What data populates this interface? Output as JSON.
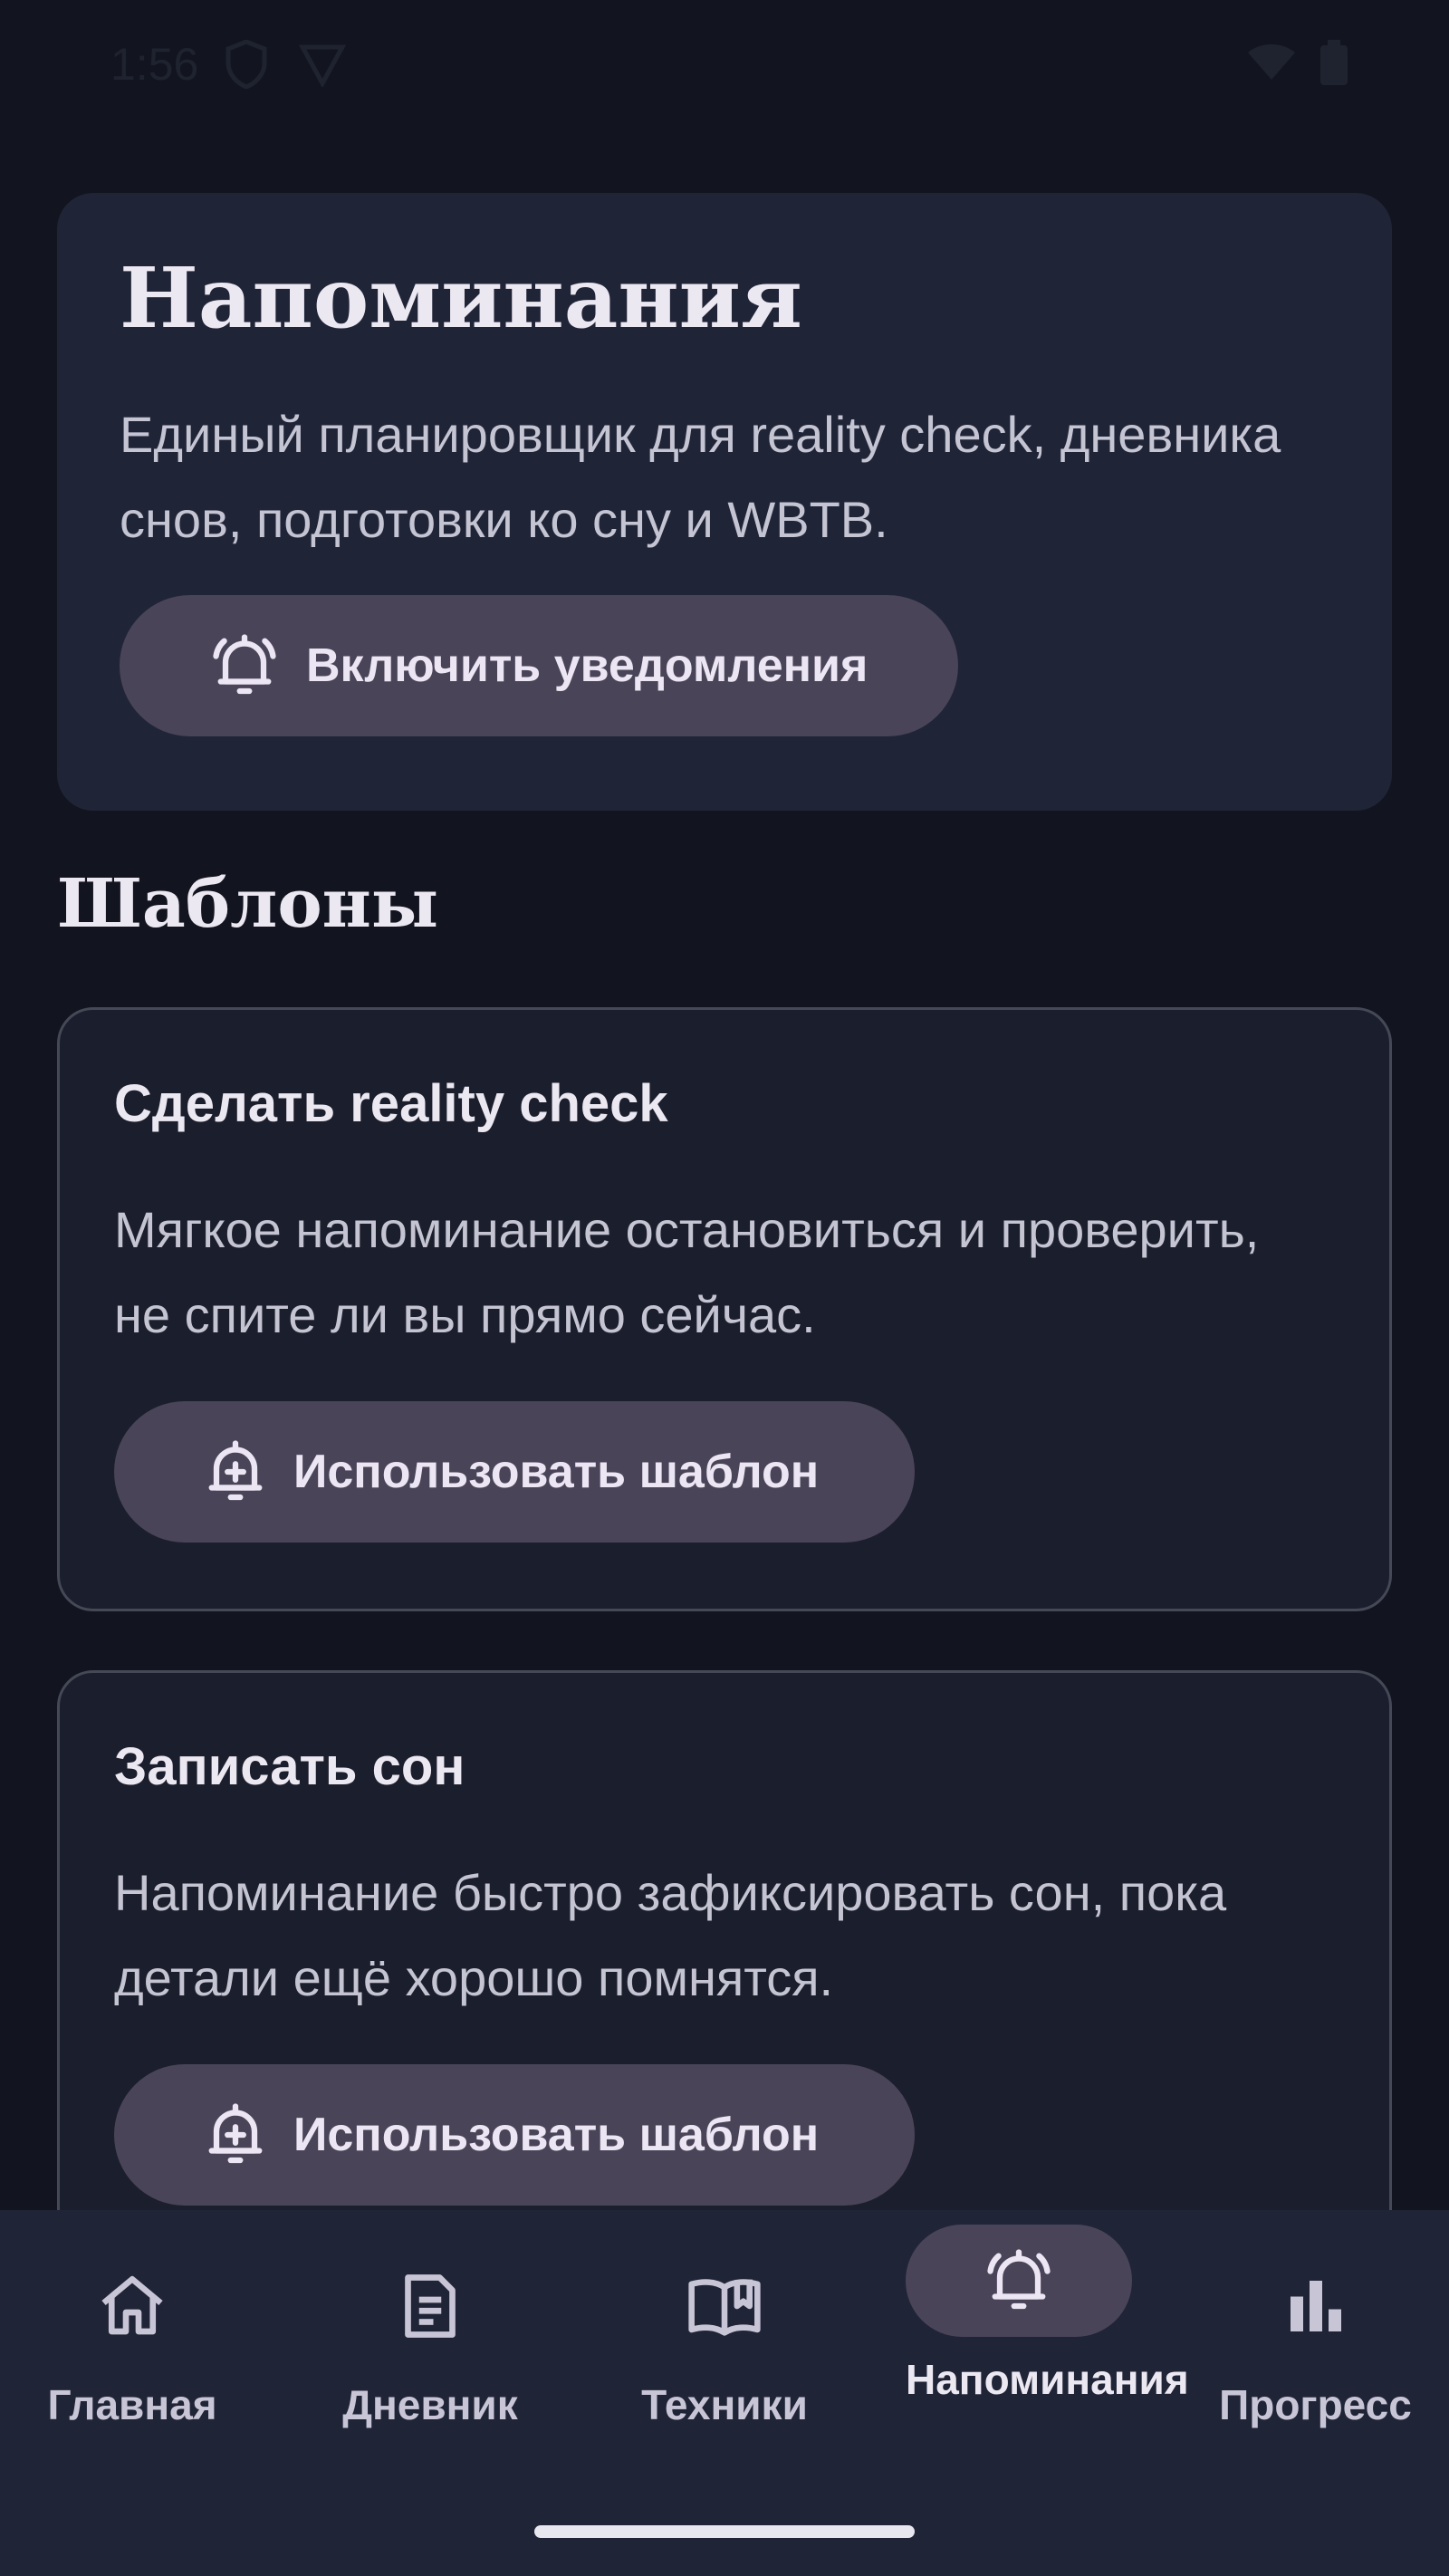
{
  "status_bar": {
    "time": "1:56"
  },
  "hero": {
    "title": "Напоминания",
    "description": "Единый планировщик для reality check, дневника снов, подготовки ко сну и WBTB.",
    "enable_button_label": "Включить уведомления"
  },
  "templates_section": {
    "title": "Шаблоны",
    "items": [
      {
        "title": "Сделать reality check",
        "description": "Мягкое напоминание остановиться и проверить, не спите ли вы прямо сейчас.",
        "button_label": "Использовать шаблон"
      },
      {
        "title": "Записать сон",
        "description": "Напоминание быстро зафиксировать сон, пока детали ещё хорошо помнятся.",
        "button_label": "Использовать шаблон"
      }
    ]
  },
  "bottom_nav": {
    "items": [
      {
        "label": "Главная",
        "icon": "home-icon"
      },
      {
        "label": "Дневник",
        "icon": "document-icon"
      },
      {
        "label": "Техники",
        "icon": "book-icon"
      },
      {
        "label": "Напоминания",
        "icon": "bell-icon",
        "active": true
      },
      {
        "label": "Прогресс",
        "icon": "bar-chart-icon"
      }
    ]
  },
  "colors": {
    "background": "#12151f",
    "card": "#1f2437",
    "button": "#4a4459",
    "accent_text": "#ece6f4"
  }
}
